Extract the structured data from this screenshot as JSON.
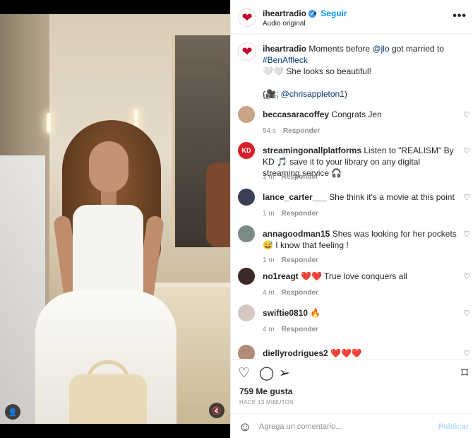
{
  "post": {
    "account": "iheartradio",
    "follow_label": "Seguir",
    "dot": "•",
    "audio_label": "Audio original",
    "more_label": "•••",
    "avatar_glyph": "❤",
    "caption": {
      "username": "iheartradio",
      "text_before_mention": " Moments before ",
      "mention_1": "@jlo",
      "text_mid": " got married to ",
      "hashtag": "#BenAffleck",
      "line2": "🤍🤍 She looks so beautiful!",
      "credit_open": "(🎥: ",
      "mention_2": "@chrisappleton1",
      "credit_close": ")",
      "time": "13 m"
    },
    "comments": [
      {
        "user": "beccasaracoffey",
        "text": "Congrats Jen",
        "time": "54 s",
        "reply": "Responder",
        "avatar_color": "#c9a487"
      },
      {
        "user": "streamingonallplatforms",
        "text": "Listen to \"REALISM\" By KD 🎵 save it to your library on any digital streaming service 🎧",
        "time": "1 m",
        "reply": "Responder",
        "avatar_color": "#d9202a",
        "avatar_text": "KD"
      },
      {
        "user": "lance_carter___",
        "text": "She think it's a movie at this point",
        "time": "1 m",
        "reply": "Responder",
        "avatar_color": "#3a3f55"
      },
      {
        "user": "annagoodman15",
        "text": "Shes was looking for her pockets 😅 I know that feeling !",
        "time": "1 m",
        "reply": "Responder",
        "avatar_color": "#7a8a86"
      },
      {
        "user": "no1reagt",
        "text": "❤️❤️ True love conquers all",
        "time": "4 m",
        "reply": "Responder",
        "avatar_color": "#3b2a26"
      },
      {
        "user": "swiftie0810",
        "text": "🔥",
        "time": "4 m",
        "reply": "Responder",
        "avatar_color": "#d6c7c2"
      },
      {
        "user": "diellyrodrigues2",
        "text": "❤️❤️❤️",
        "time": "",
        "reply": "",
        "avatar_color": "#b48a78"
      }
    ],
    "likes": "759 Me gusta",
    "posted_when": "HACE 13 MINUTOS",
    "comment_placeholder": "Agrega un comentario...",
    "post_label": "Publicar"
  },
  "icons": {
    "heart": "♡",
    "comment": "◯",
    "share": "➢",
    "bookmark": "⌑",
    "emoji": "☺",
    "user_tag": "👤",
    "mute": "🔇",
    "verified": "✓"
  },
  "colors": {
    "accent": "#0095f6",
    "brand": "#c6002b",
    "muted": "#8e8e8e",
    "link": "#00376b"
  }
}
